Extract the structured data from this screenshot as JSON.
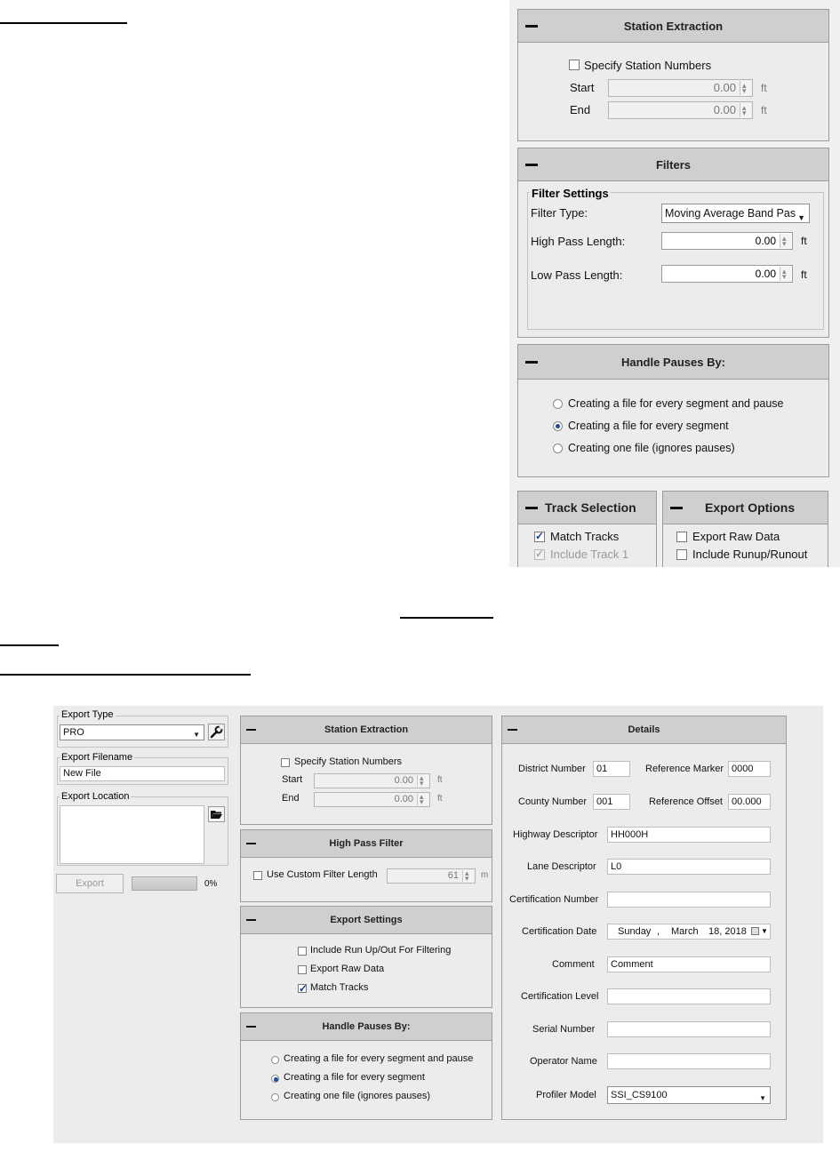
{
  "top_dialog": {
    "station_extraction": {
      "title": "Station Extraction",
      "specify_label": "Specify Station Numbers",
      "start_label": "Start",
      "start_value": "0.00",
      "end_label": "End",
      "end_value": "0.00",
      "unit": "ft"
    },
    "filters": {
      "title": "Filters",
      "group_title": "Filter Settings",
      "filter_type_label": "Filter Type:",
      "filter_type_value": "Moving Average Band Pas",
      "high_pass_label": "High Pass Length:",
      "high_pass_value": "0.00",
      "low_pass_label": "Low Pass Length:",
      "low_pass_value": "0.00",
      "unit": "ft"
    },
    "handle_pauses": {
      "title": "Handle Pauses By:",
      "options": [
        "Creating a file for every segment and pause",
        "Creating a file for every segment",
        "Creating one file (ignores pauses)"
      ],
      "selected_index": 1
    },
    "track_selection": {
      "title": "Track Selection",
      "match_tracks": "Match Tracks",
      "include_track_1": "Include Track 1"
    },
    "export_options": {
      "title": "Export Options",
      "export_raw": "Export Raw Data",
      "include_runup": "Include Runup/Runout"
    }
  },
  "bottom_dialog": {
    "export_type_label": "Export Type",
    "export_type_value": "PRO",
    "export_filename_label": "Export Filename",
    "export_filename_value": "New File",
    "export_location_label": "Export Location",
    "export_button": "Export",
    "progress_text": "0%",
    "station_extraction": {
      "title": "Station Extraction",
      "specify_label": "Specify Station Numbers",
      "start_label": "Start",
      "start_value": "0.00",
      "end_label": "End",
      "end_value": "0.00",
      "unit": "ft"
    },
    "high_pass": {
      "title": "High Pass Filter",
      "custom_label": "Use Custom Filter Length",
      "value": "61",
      "unit": "m"
    },
    "export_settings": {
      "title": "Export Settings",
      "runup_label": "Include Run Up/Out For Filtering",
      "raw_label": "Export Raw Data",
      "match_label": "Match Tracks"
    },
    "handle_pauses": {
      "title": "Handle Pauses By:",
      "options": [
        "Creating a file for every segment and pause",
        "Creating a file for every segment",
        "Creating one file (ignores pauses)"
      ],
      "selected_index": 1
    },
    "details": {
      "title": "Details",
      "district_label": "District Number",
      "district_value": "01",
      "ref_marker_label": "Reference Marker",
      "ref_marker_value": "0000",
      "county_label": "County Number",
      "county_value": "001",
      "ref_offset_label": "Reference Offset",
      "ref_offset_value": "00.000",
      "highway_label": "Highway Descriptor",
      "highway_value": "HH000H",
      "lane_label": "Lane Descriptor",
      "lane_value": "L0",
      "cert_number_label": "Certification Number",
      "cert_number_value": "",
      "cert_date_label": "Certification Date",
      "cert_date_day": "Sunday",
      "cert_date_sep": ",",
      "cert_date_month": "March",
      "cert_date_rest": "18, 2018",
      "comment_label": "Comment",
      "comment_value": "Comment",
      "cert_level_label": "Certification Level",
      "cert_level_value": "",
      "serial_label": "Serial Number",
      "serial_value": "",
      "operator_label": "Operator Name",
      "operator_value": "",
      "profiler_label": "Profiler Model",
      "profiler_value": "SSI_CS9100"
    }
  }
}
